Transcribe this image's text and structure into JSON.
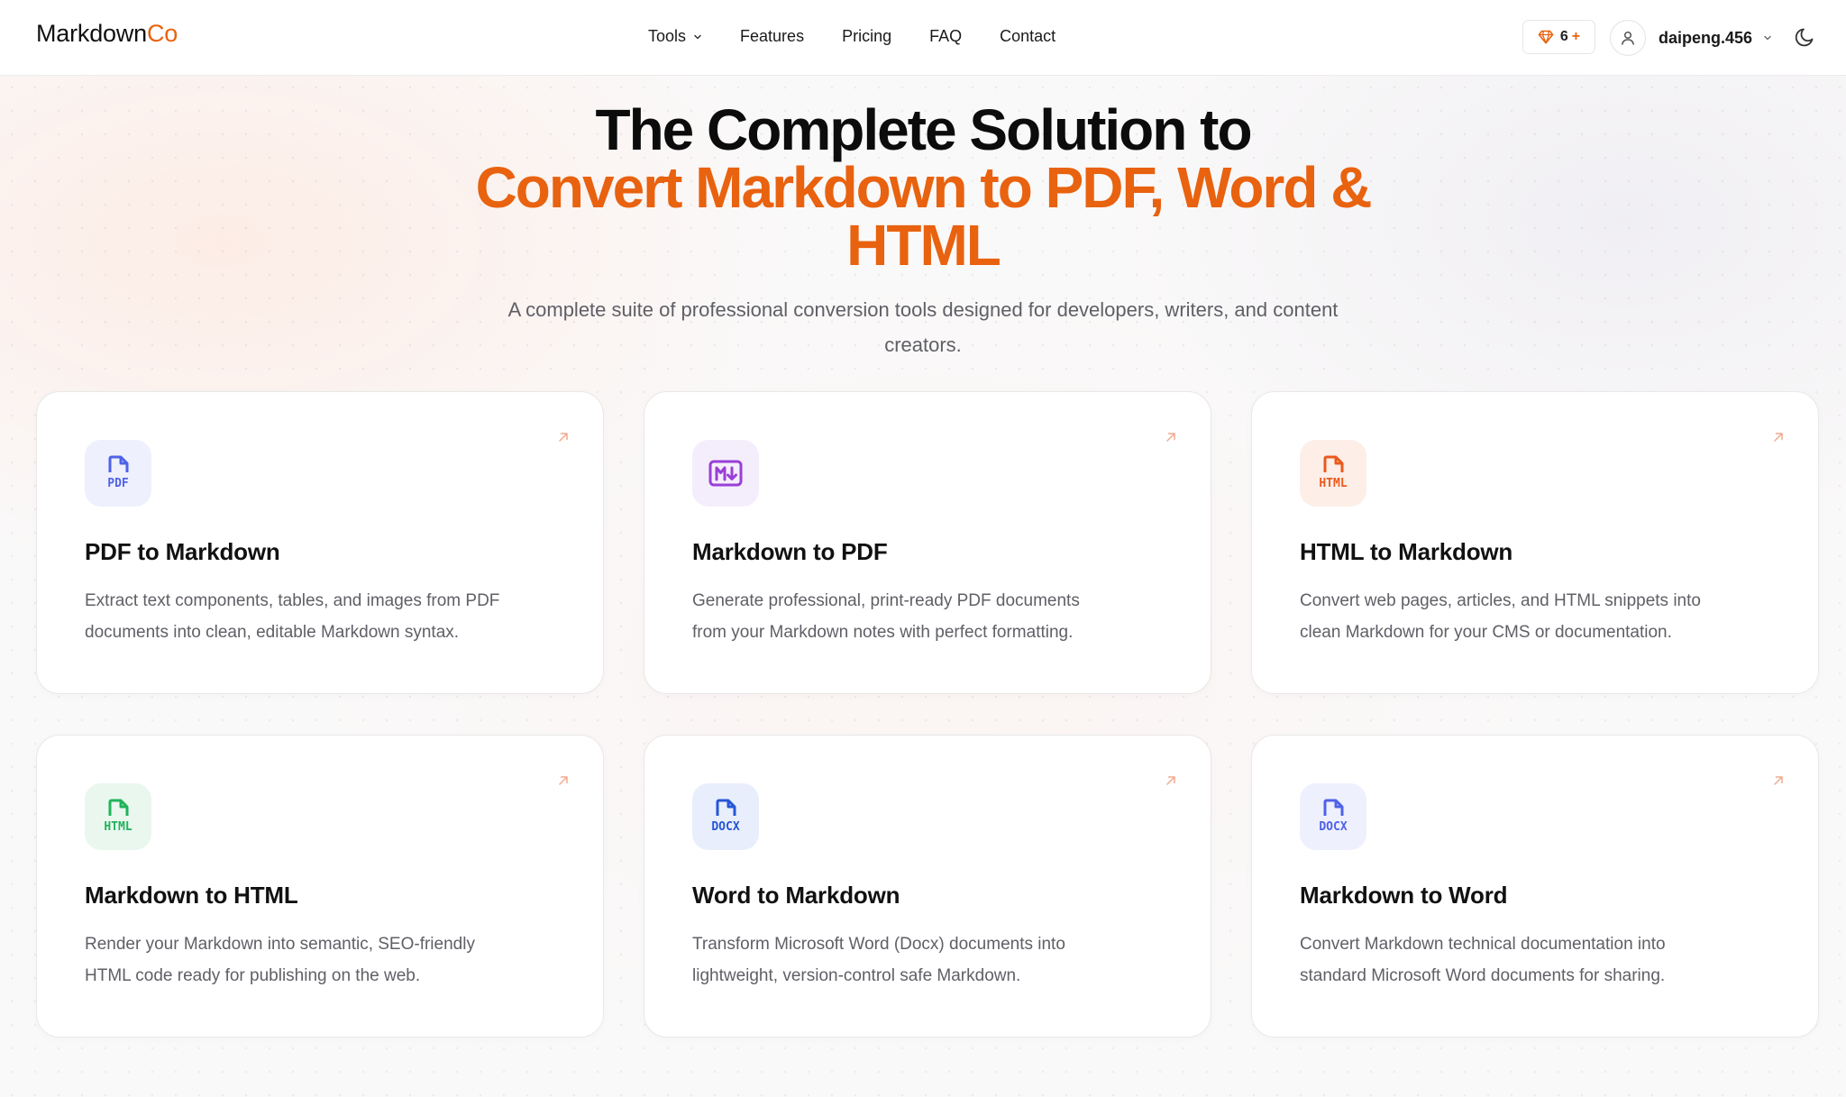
{
  "header": {
    "logo": {
      "part1": "Markdown",
      "part2": "Co"
    },
    "nav": [
      {
        "label": "Tools"
      },
      {
        "label": "Features"
      },
      {
        "label": "Pricing"
      },
      {
        "label": "FAQ"
      },
      {
        "label": "Contact"
      }
    ],
    "credits": {
      "count": "6",
      "plus": "+"
    },
    "username": "daipeng.456"
  },
  "hero": {
    "title_line1": "The Complete Solution to",
    "title_line2": "Convert Markdown to PDF, Word &",
    "title_line3": "HTML",
    "subtitle_line1": "A complete suite of professional conversion tools designed for developers, writers, and content",
    "subtitle_line2": "creators."
  },
  "cards": [
    {
      "title": "PDF to Markdown",
      "desc_line1": "Extract text components, tables, and images from PDF",
      "desc_line2": "documents into clean, editable Markdown syntax.",
      "icon": "pdf-file-icon",
      "icon_label": "PDF",
      "icon_color": "#4f62e8",
      "icon_bg": "#eef0fd"
    },
    {
      "title": "Markdown to PDF",
      "desc_line1": "Generate professional, print-ready PDF documents",
      "desc_line2": "from your Markdown notes with perfect formatting.",
      "icon": "markdown-icon",
      "icon_label": "M↓",
      "icon_color": "#9a3fd6",
      "icon_bg": "#f4eefc"
    },
    {
      "title": "HTML to Markdown",
      "desc_line1": "Convert web pages, articles, and HTML snippets into",
      "desc_line2": "clean Markdown for your CMS or documentation.",
      "icon": "html-file-icon",
      "icon_label": "HTML",
      "icon_color": "#ea5a1c",
      "icon_bg": "#fdeee8"
    },
    {
      "title": "Markdown to HTML",
      "desc_line1": "Render your Markdown into semantic, SEO-friendly",
      "desc_line2": "HTML code ready for publishing on the web.",
      "icon": "html-file-icon",
      "icon_label": "HTML",
      "icon_color": "#20b35a",
      "icon_bg": "#eaf7ef"
    },
    {
      "title": "Word to Markdown",
      "desc_line1": "Transform Microsoft Word (Docx) documents into",
      "desc_line2": "lightweight, version-control safe Markdown.",
      "icon": "docx-file-icon",
      "icon_label": "DOCX",
      "icon_color": "#2557d6",
      "icon_bg": "#e9eefc"
    },
    {
      "title": "Markdown to Word",
      "desc_line1": "Convert Markdown technical documentation into",
      "desc_line2": "standard Microsoft Word documents for sharing.",
      "icon": "docx-file-icon",
      "icon_label": "DOCX",
      "icon_color": "#4f62e8",
      "icon_bg": "#eef0fd"
    }
  ],
  "colors": {
    "accent": "#e8620f",
    "text": "#111111",
    "muted": "#5f5f66"
  }
}
